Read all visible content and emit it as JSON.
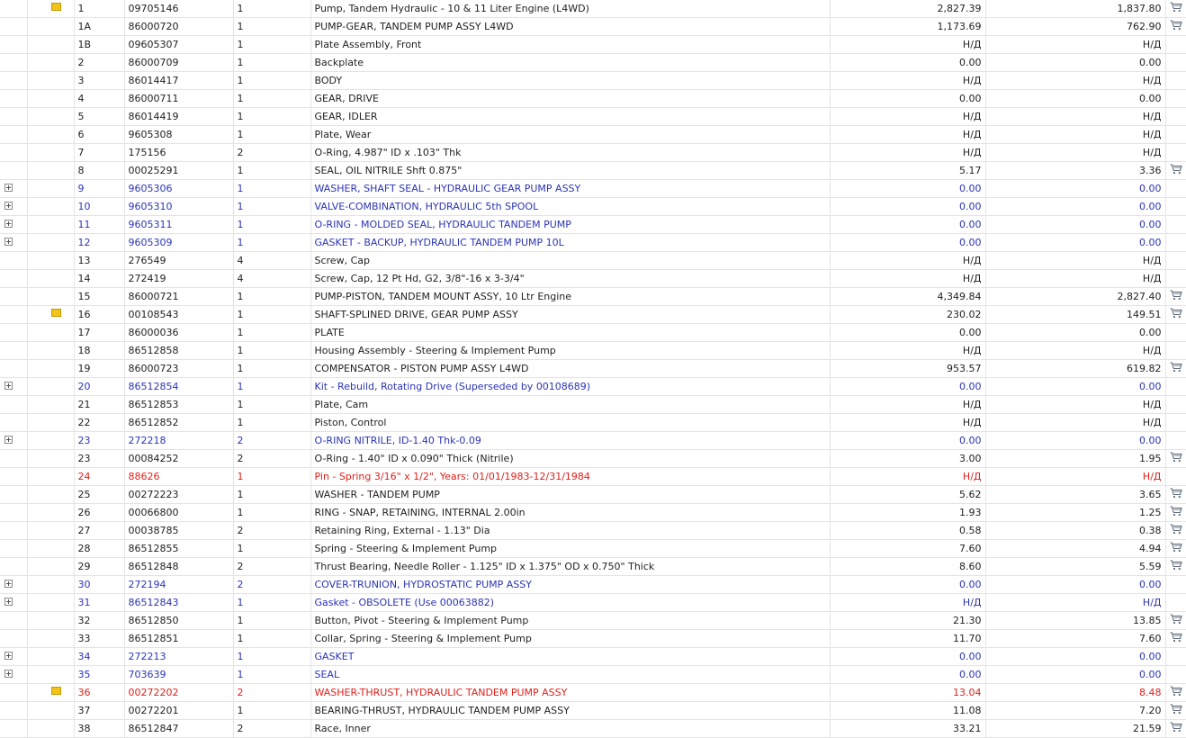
{
  "rows": [
    {
      "num": "1",
      "part": "09705146",
      "qty": "1",
      "desc": "Pump, Tandem Hydraulic - 10 & 11 Liter Engine (L4WD)",
      "price": "2,827.39",
      "price2": "1,837.80",
      "cart": true,
      "note": true,
      "expand": false,
      "style": "normal"
    },
    {
      "num": "1A",
      "part": "86000720",
      "qty": "1",
      "desc": "PUMP-GEAR, TANDEM PUMP ASSY L4WD",
      "price": "1,173.69",
      "price2": "762.90",
      "cart": true,
      "note": false,
      "expand": false,
      "style": "normal"
    },
    {
      "num": "1B",
      "part": "09605307",
      "qty": "1",
      "desc": "Plate Assembly, Front",
      "price": "Н/Д",
      "price2": "Н/Д",
      "cart": false,
      "note": false,
      "expand": false,
      "style": "normal"
    },
    {
      "num": "2",
      "part": "86000709",
      "qty": "1",
      "desc": "Backplate",
      "price": "0.00",
      "price2": "0.00",
      "cart": false,
      "note": false,
      "expand": false,
      "style": "normal"
    },
    {
      "num": "3",
      "part": "86014417",
      "qty": "1",
      "desc": "BODY",
      "price": "Н/Д",
      "price2": "Н/Д",
      "cart": false,
      "note": false,
      "expand": false,
      "style": "normal"
    },
    {
      "num": "4",
      "part": "86000711",
      "qty": "1",
      "desc": "GEAR, DRIVE",
      "price": "0.00",
      "price2": "0.00",
      "cart": false,
      "note": false,
      "expand": false,
      "style": "normal"
    },
    {
      "num": "5",
      "part": "86014419",
      "qty": "1",
      "desc": "GEAR, IDLER",
      "price": "Н/Д",
      "price2": "Н/Д",
      "cart": false,
      "note": false,
      "expand": false,
      "style": "normal"
    },
    {
      "num": "6",
      "part": "9605308",
      "qty": "1",
      "desc": "Plate, Wear",
      "price": "Н/Д",
      "price2": "Н/Д",
      "cart": false,
      "note": false,
      "expand": false,
      "style": "normal"
    },
    {
      "num": "7",
      "part": "175156",
      "qty": "2",
      "desc": "O-Ring, 4.987\" ID x .103\" Thk",
      "price": "Н/Д",
      "price2": "Н/Д",
      "cart": false,
      "note": false,
      "expand": false,
      "style": "normal"
    },
    {
      "num": "8",
      "part": "00025291",
      "qty": "1",
      "desc": "SEAL, OIL NITRILE Shft 0.875\"",
      "price": "5.17",
      "price2": "3.36",
      "cart": true,
      "note": false,
      "expand": false,
      "style": "normal"
    },
    {
      "num": "9",
      "part": "9605306",
      "qty": "1",
      "desc": "WASHER, SHAFT SEAL - HYDRAULIC GEAR PUMP ASSY",
      "price": "0.00",
      "price2": "0.00",
      "cart": false,
      "note": false,
      "expand": true,
      "style": "blue"
    },
    {
      "num": "10",
      "part": "9605310",
      "qty": "1",
      "desc": "VALVE-COMBINATION, HYDRAULIC 5th SPOOL",
      "price": "0.00",
      "price2": "0.00",
      "cart": false,
      "note": false,
      "expand": true,
      "style": "blue"
    },
    {
      "num": "11",
      "part": "9605311",
      "qty": "1",
      "desc": "O-RING - MOLDED SEAL, HYDRAULIC TANDEM PUMP",
      "price": "0.00",
      "price2": "0.00",
      "cart": false,
      "note": false,
      "expand": true,
      "style": "blue"
    },
    {
      "num": "12",
      "part": "9605309",
      "qty": "1",
      "desc": "GASKET - BACKUP, HYDRAULIC TANDEM PUMP 10L",
      "price": "0.00",
      "price2": "0.00",
      "cart": false,
      "note": false,
      "expand": true,
      "style": "blue"
    },
    {
      "num": "13",
      "part": "276549",
      "qty": "4",
      "desc": "Screw, Cap",
      "price": "Н/Д",
      "price2": "Н/Д",
      "cart": false,
      "note": false,
      "expand": false,
      "style": "normal"
    },
    {
      "num": "14",
      "part": "272419",
      "qty": "4",
      "desc": "Screw, Cap, 12 Pt Hd, G2, 3/8\"-16 x 3-3/4\"",
      "price": "Н/Д",
      "price2": "Н/Д",
      "cart": false,
      "note": false,
      "expand": false,
      "style": "normal"
    },
    {
      "num": "15",
      "part": "86000721",
      "qty": "1",
      "desc": "PUMP-PISTON, TANDEM MOUNT ASSY, 10 Ltr Engine",
      "price": "4,349.84",
      "price2": "2,827.40",
      "cart": true,
      "note": false,
      "expand": false,
      "style": "normal"
    },
    {
      "num": "16",
      "part": "00108543",
      "qty": "1",
      "desc": "SHAFT-SPLINED DRIVE, GEAR PUMP ASSY",
      "price": "230.02",
      "price2": "149.51",
      "cart": true,
      "note": true,
      "expand": false,
      "style": "normal"
    },
    {
      "num": "17",
      "part": "86000036",
      "qty": "1",
      "desc": "PLATE",
      "price": "0.00",
      "price2": "0.00",
      "cart": false,
      "note": false,
      "expand": false,
      "style": "normal"
    },
    {
      "num": "18",
      "part": "86512858",
      "qty": "1",
      "desc": "Housing Assembly - Steering & Implement Pump",
      "price": "Н/Д",
      "price2": "Н/Д",
      "cart": false,
      "note": false,
      "expand": false,
      "style": "normal"
    },
    {
      "num": "19",
      "part": "86000723",
      "qty": "1",
      "desc": "COMPENSATOR - PISTON PUMP ASSY L4WD",
      "price": "953.57",
      "price2": "619.82",
      "cart": true,
      "note": false,
      "expand": false,
      "style": "normal"
    },
    {
      "num": "20",
      "part": "86512854",
      "qty": "1",
      "desc": "Kit - Rebuild, Rotating Drive (Superseded by 00108689)",
      "price": "0.00",
      "price2": "0.00",
      "cart": false,
      "note": false,
      "expand": true,
      "style": "blue"
    },
    {
      "num": "21",
      "part": "86512853",
      "qty": "1",
      "desc": "Plate, Cam",
      "price": "Н/Д",
      "price2": "Н/Д",
      "cart": false,
      "note": false,
      "expand": false,
      "style": "normal"
    },
    {
      "num": "22",
      "part": "86512852",
      "qty": "1",
      "desc": "Piston, Control",
      "price": "Н/Д",
      "price2": "Н/Д",
      "cart": false,
      "note": false,
      "expand": false,
      "style": "normal"
    },
    {
      "num": "23",
      "part": "272218",
      "qty": "2",
      "desc": "O-RING NITRILE, ID-1.40 Thk-0.09",
      "price": "0.00",
      "price2": "0.00",
      "cart": false,
      "note": false,
      "expand": true,
      "style": "blue"
    },
    {
      "num": "23",
      "part": "00084252",
      "qty": "2",
      "desc": "O-Ring - 1.40\" ID x 0.090\" Thick (Nitrile)",
      "price": "3.00",
      "price2": "1.95",
      "cart": true,
      "note": false,
      "expand": false,
      "style": "normal"
    },
    {
      "num": "24",
      "part": "88626",
      "qty": "1",
      "desc": "Pin - Spring 3/16\" x 1/2\", Years: 01/01/1983-12/31/1984",
      "price": "Н/Д",
      "price2": "Н/Д",
      "cart": false,
      "note": false,
      "expand": false,
      "style": "red"
    },
    {
      "num": "25",
      "part": "00272223",
      "qty": "1",
      "desc": "WASHER - TANDEM PUMP",
      "price": "5.62",
      "price2": "3.65",
      "cart": true,
      "note": false,
      "expand": false,
      "style": "normal"
    },
    {
      "num": "26",
      "part": "00066800",
      "qty": "1",
      "desc": "RING - SNAP, RETAINING, INTERNAL 2.00in",
      "price": "1.93",
      "price2": "1.25",
      "cart": true,
      "note": false,
      "expand": false,
      "style": "normal"
    },
    {
      "num": "27",
      "part": "00038785",
      "qty": "2",
      "desc": "Retaining Ring, External - 1.13\" Dia",
      "price": "0.58",
      "price2": "0.38",
      "cart": true,
      "note": false,
      "expand": false,
      "style": "normal"
    },
    {
      "num": "28",
      "part": "86512855",
      "qty": "1",
      "desc": "Spring - Steering & Implement Pump",
      "price": "7.60",
      "price2": "4.94",
      "cart": true,
      "note": false,
      "expand": false,
      "style": "normal"
    },
    {
      "num": "29",
      "part": "86512848",
      "qty": "2",
      "desc": "Thrust Bearing, Needle Roller - 1.125\" ID x 1.375\" OD x 0.750\" Thick",
      "price": "8.60",
      "price2": "5.59",
      "cart": true,
      "note": false,
      "expand": false,
      "style": "normal"
    },
    {
      "num": "30",
      "part": "272194",
      "qty": "2",
      "desc": "COVER-TRUNION, HYDROSTATIC PUMP ASSY",
      "price": "0.00",
      "price2": "0.00",
      "cart": false,
      "note": false,
      "expand": true,
      "style": "blue"
    },
    {
      "num": "31",
      "part": "86512843",
      "qty": "1",
      "desc": "Gasket - OBSOLETE (Use 00063882)",
      "price": "Н/Д",
      "price2": "Н/Д",
      "cart": false,
      "note": false,
      "expand": true,
      "style": "blue"
    },
    {
      "num": "32",
      "part": "86512850",
      "qty": "1",
      "desc": "Button, Pivot - Steering & Implement Pump",
      "price": "21.30",
      "price2": "13.85",
      "cart": true,
      "note": false,
      "expand": false,
      "style": "normal"
    },
    {
      "num": "33",
      "part": "86512851",
      "qty": "1",
      "desc": "Collar, Spring - Steering & Implement Pump",
      "price": "11.70",
      "price2": "7.60",
      "cart": true,
      "note": false,
      "expand": false,
      "style": "normal"
    },
    {
      "num": "34",
      "part": "272213",
      "qty": "1",
      "desc": "GASKET",
      "price": "0.00",
      "price2": "0.00",
      "cart": false,
      "note": false,
      "expand": true,
      "style": "blue"
    },
    {
      "num": "35",
      "part": "703639",
      "qty": "1",
      "desc": "SEAL",
      "price": "0.00",
      "price2": "0.00",
      "cart": false,
      "note": false,
      "expand": true,
      "style": "blue"
    },
    {
      "num": "36",
      "part": "00272202",
      "qty": "2",
      "desc": "WASHER-THRUST, HYDRAULIC TANDEM PUMP ASSY",
      "price": "13.04",
      "price2": "8.48",
      "cart": true,
      "note": true,
      "expand": false,
      "style": "red"
    },
    {
      "num": "37",
      "part": "00272201",
      "qty": "1",
      "desc": "BEARING-THRUST, HYDRAULIC TANDEM PUMP ASSY",
      "price": "11.08",
      "price2": "7.20",
      "cart": true,
      "note": false,
      "expand": false,
      "style": "normal"
    },
    {
      "num": "38",
      "part": "86512847",
      "qty": "2",
      "desc": "Race, Inner",
      "price": "33.21",
      "price2": "21.59",
      "cart": true,
      "note": false,
      "expand": false,
      "style": "normal"
    }
  ]
}
